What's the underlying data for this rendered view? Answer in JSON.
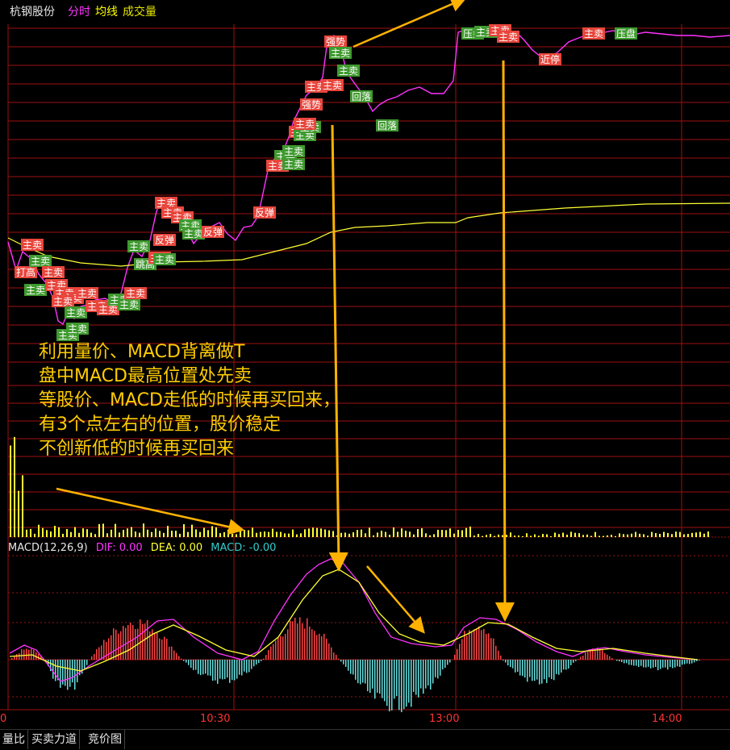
{
  "header": {
    "stock_name": "杭钢股份",
    "tab_fenshi": "分时",
    "tab_junxian": "均线",
    "tab_volume": "成交量"
  },
  "annotation": {
    "lines": [
      "利用量价、MACD背离做T",
      "盘中MACD最高位置处先卖",
      "等股价、MACD走低的时候再买回来，",
      "有3个点左右的位置，股价稳定",
      "不创新低的时候再买回来"
    ]
  },
  "macd_legend": {
    "label": "MACD(12,26,9)",
    "dif": "DIF: 0.00",
    "dea": "DEA: 0.00",
    "macd": "MACD: -0.00"
  },
  "time_axis": {
    "labels": [
      "0",
      "10:30",
      "13:00",
      "14:00"
    ]
  },
  "bottom_tabs": [
    "量比",
    "买卖力道",
    "竞价图"
  ],
  "signals": [
    {
      "text": "主卖",
      "color": "#e8453c"
    },
    {
      "text": "打高",
      "color": "#e8453c"
    },
    {
      "text": "主卖",
      "color": "#3f9a2f"
    },
    {
      "text": "主卖",
      "color": "#e8453c"
    },
    {
      "text": "主卖",
      "color": "#3f9a2f"
    },
    {
      "text": "主卖",
      "color": "#e8453c"
    },
    {
      "text": "主卖",
      "color": "#e8453c"
    },
    {
      "text": "主卖",
      "color": "#e8453c"
    },
    {
      "text": "主卖",
      "color": "#e8453c"
    },
    {
      "text": "主卖",
      "color": "#3f9a2f"
    },
    {
      "text": "主卖",
      "color": "#e8453c"
    },
    {
      "text": "主卖",
      "color": "#3f9a2f"
    },
    {
      "text": "主卖",
      "color": "#3f9a2f"
    },
    {
      "text": "主卖",
      "color": "#e8453c"
    },
    {
      "text": "主卖",
      "color": "#e8453c"
    },
    {
      "text": "主卖",
      "color": "#3f9a2f"
    },
    {
      "text": "主卖",
      "color": "#3f9a2f"
    },
    {
      "text": "主卖",
      "color": "#e8453c"
    },
    {
      "text": "主卖",
      "color": "#3f9a2f"
    },
    {
      "text": "跳高",
      "color": "#3f9a2f"
    },
    {
      "text": "主卖",
      "color": "#e8453c"
    },
    {
      "text": "主卖",
      "color": "#3f9a2f"
    },
    {
      "text": "反弹",
      "color": "#e8453c"
    },
    {
      "text": "主卖",
      "color": "#e8453c"
    },
    {
      "text": "主卖",
      "color": "#e8453c"
    },
    {
      "text": "主卖",
      "color": "#e8453c"
    },
    {
      "text": "主卖",
      "color": "#3f9a2f"
    },
    {
      "text": "主卖",
      "color": "#3f9a2f"
    },
    {
      "text": "反弹",
      "color": "#e8453c"
    },
    {
      "text": "反弹",
      "color": "#e8453c"
    },
    {
      "text": "主卖",
      "color": "#3f9a2f"
    },
    {
      "text": "主卖",
      "color": "#e8453c"
    },
    {
      "text": "主卖",
      "color": "#3f9a2f"
    },
    {
      "text": "主卖",
      "color": "#3f9a2f"
    },
    {
      "text": "主卖",
      "color": "#e8453c"
    },
    {
      "text": "主卖",
      "color": "#3f9a2f"
    },
    {
      "text": "主卖",
      "color": "#3f9a2f"
    },
    {
      "text": "主卖",
      "color": "#e8453c"
    },
    {
      "text": "强势",
      "color": "#e8453c"
    },
    {
      "text": "主卖",
      "color": "#e8453c"
    },
    {
      "text": "主卖",
      "color": "#e8453c"
    },
    {
      "text": "强势",
      "color": "#e8453c"
    },
    {
      "text": "主卖",
      "color": "#3f9a2f"
    },
    {
      "text": "主卖",
      "color": "#3f9a2f"
    },
    {
      "text": "回落",
      "color": "#3f9a2f"
    },
    {
      "text": "回落",
      "color": "#3f9a2f"
    },
    {
      "text": "压盘",
      "color": "#3f9a2f"
    },
    {
      "text": "主卖",
      "color": "#3f9a2f"
    },
    {
      "text": "主卖",
      "color": "#e8453c"
    },
    {
      "text": "主卖",
      "color": "#e8453c"
    },
    {
      "text": "近停",
      "color": "#e8453c"
    },
    {
      "text": "主卖",
      "color": "#e8453c"
    },
    {
      "text": "压盘",
      "color": "#3f9a2f"
    }
  ],
  "colors": {
    "grid": "#a01010",
    "price_line": "#ff33ff",
    "avg_line": "#ffff33",
    "volume_bar": "#ffff33",
    "macd_up": "#ff4444",
    "macd_down": "#66e0e0",
    "arrow": "#ffb300"
  }
}
